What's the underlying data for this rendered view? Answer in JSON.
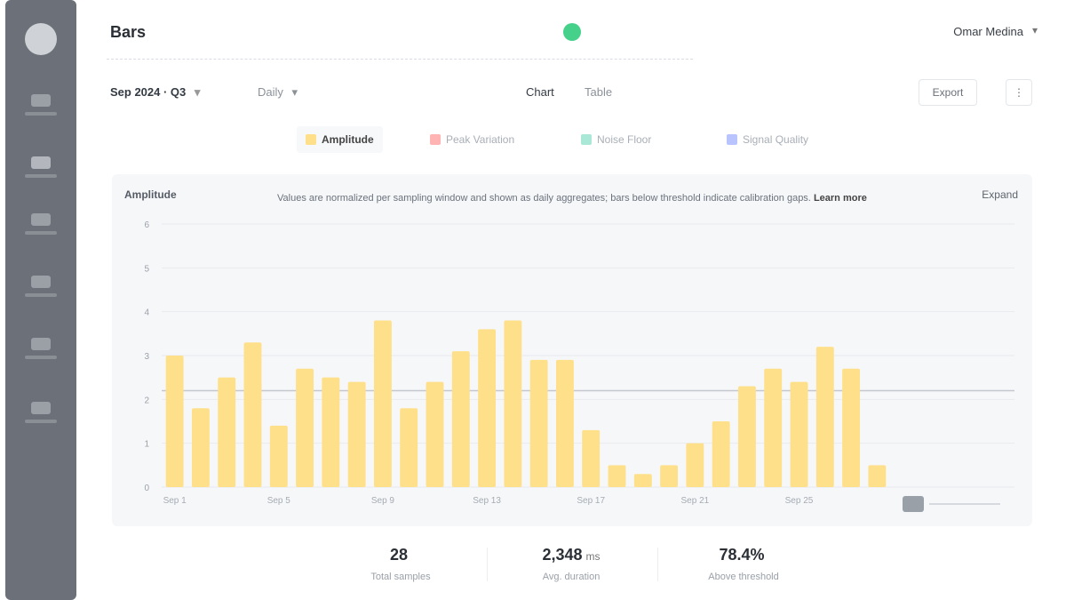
{
  "app": {
    "title": "Bars",
    "user_label": "Omar Medina",
    "user_caret": "▾"
  },
  "sidebar": {
    "items": [
      {
        "icon": "home-icon"
      },
      {
        "icon": "chart-icon"
      },
      {
        "icon": "grid-icon"
      },
      {
        "icon": "settings-icon"
      },
      {
        "icon": "folder-icon"
      },
      {
        "icon": "help-icon"
      }
    ]
  },
  "controls": {
    "range_label": "Sep 2024 · Q3",
    "range_chevron": "▾",
    "series_select": "Daily",
    "series_chevron": "▾",
    "view_label": "Chart",
    "view_alt": "Table",
    "action_label": "Export",
    "more_label": "⋮"
  },
  "legend": [
    {
      "label": "Amplitude",
      "color": "#ffe08a",
      "active": true
    },
    {
      "label": "Peak Variation",
      "color": "#ffb3b3",
      "active": false
    },
    {
      "label": "Noise Floor",
      "color": "#a9e8d6",
      "active": false
    },
    {
      "label": "Signal Quality",
      "color": "#b9c4ff",
      "active": false
    }
  ],
  "chart_card": {
    "title": "Amplitude",
    "note": "Values are normalized per sampling window and shown as daily aggregates; bars below threshold indicate calibration gaps.",
    "note_link": "Learn more",
    "export_label": "Expand"
  },
  "chart_data": {
    "type": "bar",
    "series_name": "Amplitude",
    "color": "#ffe08a",
    "ylim": [
      0,
      6
    ],
    "yticks": [
      "0",
      "1",
      "2",
      "3",
      "4",
      "5",
      "6"
    ],
    "threshold": 2.2,
    "values": [
      3.0,
      1.8,
      2.5,
      3.3,
      1.4,
      2.7,
      2.5,
      2.4,
      3.8,
      1.8,
      2.4,
      3.1,
      3.6,
      3.8,
      2.9,
      2.9,
      1.3,
      0.5,
      0.3,
      0.5,
      1.0,
      1.5,
      2.3,
      2.7,
      2.4,
      3.2,
      2.7,
      0.5
    ],
    "xticks": [
      "Sep 1",
      "Sep 5",
      "Sep 9",
      "Sep 13",
      "Sep 17",
      "Sep 21",
      "Sep 25"
    ]
  },
  "stats": [
    {
      "value": "28",
      "unit": "",
      "label": "Total samples"
    },
    {
      "value": "2,348",
      "unit": "ms",
      "label": "Avg. duration"
    },
    {
      "value": "78.4%",
      "unit": "",
      "label": "Above threshold"
    }
  ]
}
